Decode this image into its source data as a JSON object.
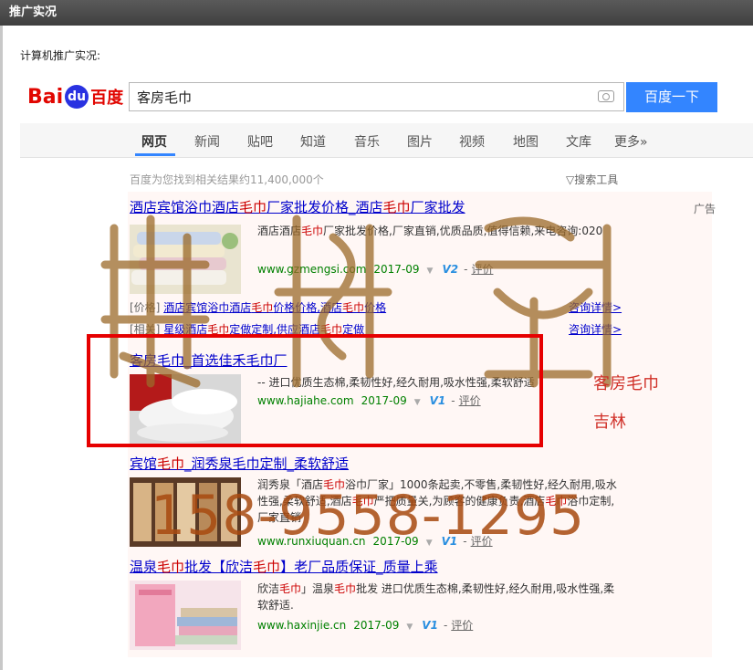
{
  "window": {
    "title": "推广实况"
  },
  "section": {
    "label": "计算机推广实况:"
  },
  "logo": {
    "bai": "Bai",
    "du": "du",
    "cn": "百度"
  },
  "search": {
    "query": "客房毛巾",
    "button": "百度一下"
  },
  "nav": {
    "items": [
      "网页",
      "新闻",
      "贴吧",
      "知道",
      "音乐",
      "图片",
      "视频",
      "地图",
      "文库",
      "更多»"
    ],
    "active": "网页"
  },
  "stats": {
    "text": "百度为您找到相关结果约11,400,000个",
    "tools": "搜索工具"
  },
  "ad_label": "广告",
  "results": [
    {
      "title_parts": [
        "酒店宾馆浴巾酒店",
        "毛巾",
        "厂家批发价格_酒店",
        "毛巾",
        "厂家批发"
      ],
      "desc_parts": [
        "酒店酒店",
        "毛巾",
        "厂家批发价格,厂家直销,优质品质,值得信赖,来电咨询:020"
      ],
      "url": "www.gzmengsi.com",
      "date": "2017-09",
      "v_level": "V2",
      "review": "评价",
      "sublinks": [
        {
          "prefix": "[价格]",
          "parts": [
            "酒店宾馆浴巾酒店",
            "毛巾",
            "价格价格,酒店",
            "毛巾",
            "价格"
          ],
          "detail": "咨询详情>"
        },
        {
          "prefix": "[相关]",
          "parts": [
            "星级酒店",
            "毛巾",
            "定做定制,供应酒店",
            "毛巾",
            "定做"
          ],
          "detail": "咨询详情>"
        }
      ]
    },
    {
      "title_parts": [
        "客房毛巾_首选佳禾毛巾厂"
      ],
      "desc": "-- 进口优质生态棉,柔韧性好,经久耐用,吸水性强,柔软舒适",
      "url": "www.hajiahe.com",
      "date": "2017-09",
      "v_level": "V1",
      "review": "评价"
    },
    {
      "title_parts": [
        "宾馆",
        "毛巾",
        "_润秀泉毛巾定制_柔软舒适"
      ],
      "desc_parts": [
        "润秀泉「酒店",
        "毛巾",
        "浴巾厂家」1000条起卖,不零售,柔韧性好,经久耐用,吸水性强,柔软舒适,酒店",
        "毛巾",
        "严把质量关,为顾客的健康负责,酒店",
        "毛巾",
        "浴巾定制,厂家直销"
      ],
      "url": "www.runxiuquan.cn",
      "date": "2017-09",
      "v_level": "V1",
      "review": "评价"
    },
    {
      "title_parts": [
        "温泉",
        "毛巾",
        "批发【欣洁",
        "毛巾",
        "】老厂品质保证_质量上乘"
      ],
      "desc_parts": [
        "欣洁",
        "毛巾",
        "」温泉",
        "毛巾",
        "批发 进口优质生态棉,柔韧性好,经久耐用,吸水性强,柔软舒适."
      ],
      "url": "www.haxinjie.cn",
      "date": "2017-09",
      "v_level": "V1",
      "review": "评价"
    }
  ],
  "annotations": {
    "keyword": "客房毛巾",
    "region": "吉林",
    "phone": "158-9558-1295"
  },
  "colors": {
    "accent": "#3385ff",
    "link": "#0000cc",
    "highlight": "#cc0000",
    "url": "#008000",
    "annotation_box": "#e60000"
  }
}
